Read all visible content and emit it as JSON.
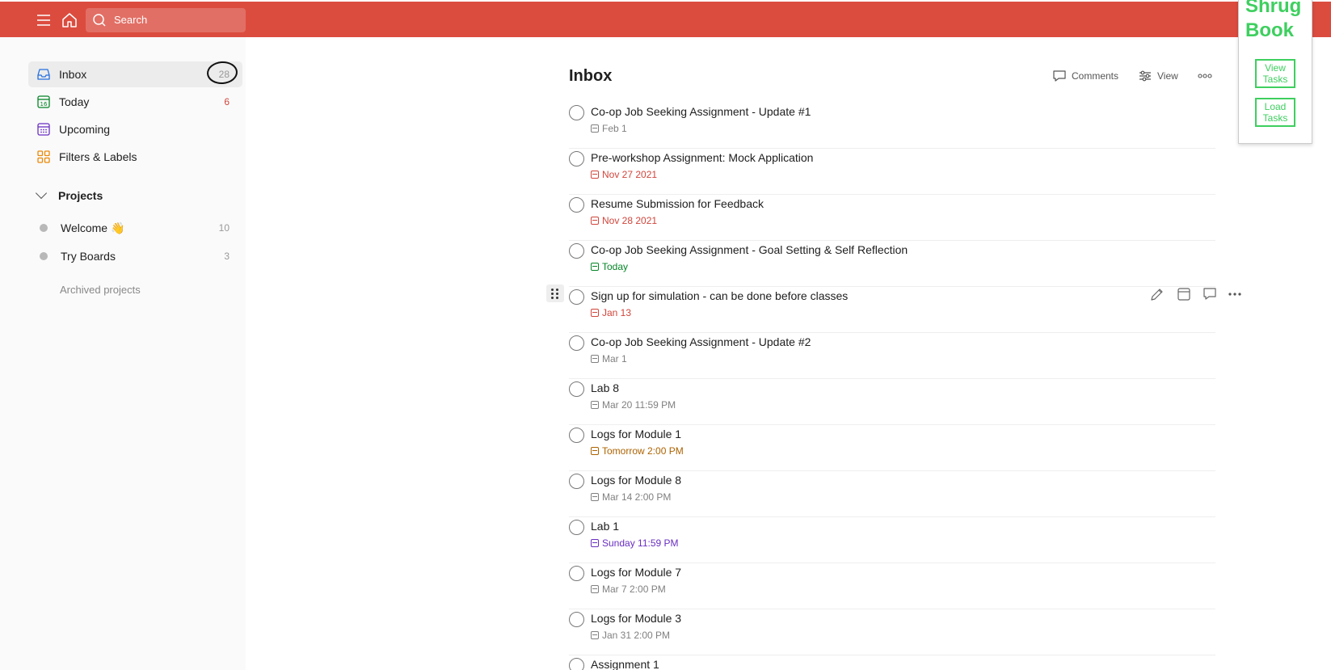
{
  "topbar": {
    "search_placeholder": "Search"
  },
  "sidebar": {
    "items": [
      {
        "label": "Inbox",
        "count": "28",
        "icon": "inbox-icon"
      },
      {
        "label": "Today",
        "count": "6",
        "icon": "calendar-today-icon"
      },
      {
        "label": "Upcoming",
        "count": "",
        "icon": "calendar-upcoming-icon"
      },
      {
        "label": "Filters & Labels",
        "count": "",
        "icon": "filters-labels-icon"
      }
    ],
    "projects_label": "Projects",
    "projects": [
      {
        "label": "Welcome 👋",
        "count": "10"
      },
      {
        "label": "Try Boards",
        "count": "3"
      }
    ],
    "archived_label": "Archived projects"
  },
  "main": {
    "title": "Inbox",
    "actions": {
      "comments": "Comments",
      "view": "View"
    },
    "tasks": [
      {
        "title": "Co-op Job Seeking Assignment - Update #1",
        "due": "Feb 1",
        "due_color": "grey"
      },
      {
        "title": "Pre-workshop Assignment: Mock Application",
        "due": "Nov 27 2021",
        "due_color": "red"
      },
      {
        "title": "Resume Submission for Feedback",
        "due": "Nov 28 2021",
        "due_color": "red"
      },
      {
        "title": "Co-op Job Seeking Assignment - Goal Setting & Self Reflection",
        "due": "Today",
        "due_color": "green"
      },
      {
        "title": "Sign up for simulation - can be done before classes",
        "due": "Jan 13",
        "due_color": "red"
      },
      {
        "title": "Co-op Job Seeking Assignment - Update #2",
        "due": "Mar 1",
        "due_color": "grey"
      },
      {
        "title": "Lab 8",
        "due": "Mar 20 11:59 PM",
        "due_color": "grey"
      },
      {
        "title": "Logs for Module 1",
        "due": "Tomorrow 2:00 PM",
        "due_color": "orange"
      },
      {
        "title": "Logs for Module 8",
        "due": "Mar 14 2:00 PM",
        "due_color": "grey"
      },
      {
        "title": "Lab 1",
        "due": "Sunday 11:59 PM",
        "due_color": "purple"
      },
      {
        "title": "Logs for Module 7",
        "due": "Mar 7 2:00 PM",
        "due_color": "grey"
      },
      {
        "title": "Logs for Module 3",
        "due": "Jan 31 2:00 PM",
        "due_color": "grey"
      },
      {
        "title": "Assignment 1",
        "due": "",
        "due_color": "grey"
      }
    ]
  },
  "shrug_book": {
    "brand_line1": "Shrug",
    "brand_line2": "Book",
    "view_tasks_line1": "View",
    "view_tasks_line2": "Tasks",
    "load_tasks_line1": "Load",
    "load_tasks_line2": "Tasks"
  },
  "colors": {
    "topbar": "#db4c3f",
    "accent_green": "#3ecf5f",
    "due_red": "#d1453b",
    "due_green": "#058527",
    "due_orange": "#ad6200",
    "due_purple": "#692fc2",
    "due_grey": "#808080"
  }
}
